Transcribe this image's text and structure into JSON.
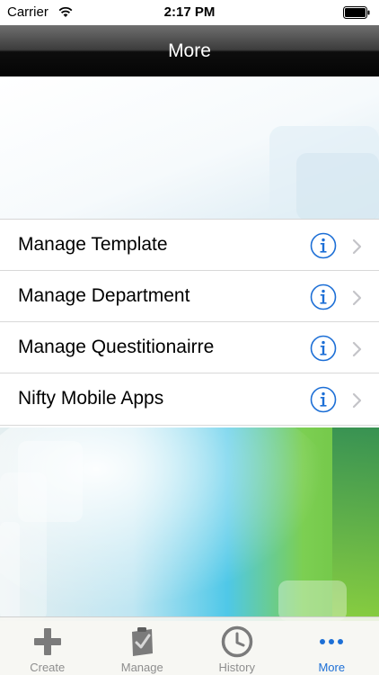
{
  "status_bar": {
    "carrier": "Carrier",
    "time": "2:17 PM"
  },
  "nav": {
    "title": "More"
  },
  "list": {
    "items": [
      {
        "label": "Manage Template"
      },
      {
        "label": "Manage Department"
      },
      {
        "label": "Manage Questitionairre"
      },
      {
        "label": "Nifty Mobile Apps"
      }
    ]
  },
  "tab_bar": {
    "tabs": [
      {
        "label": "Create",
        "icon": "plus-icon"
      },
      {
        "label": "Manage",
        "icon": "clipboard-check-icon"
      },
      {
        "label": "History",
        "icon": "clock-icon"
      },
      {
        "label": "More",
        "icon": "more-dots-icon"
      }
    ],
    "active_tab": "More"
  },
  "colors": {
    "accent_blue": "#1d6fd6",
    "tab_inactive": "#8e8e8e",
    "nav_bar": "#1a1a1a",
    "background_green": "#6cc04a",
    "background_cyan": "#4fc8e8"
  }
}
